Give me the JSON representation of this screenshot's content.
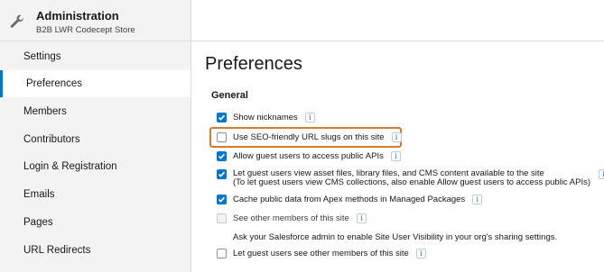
{
  "app": {
    "title": "Administration",
    "subtitle": "B2B LWR Codecept Store",
    "icon": "wrench-icon"
  },
  "sidebar": {
    "items": [
      {
        "label": "Settings",
        "active": false
      },
      {
        "label": "Preferences",
        "active": true
      },
      {
        "label": "Members",
        "active": false
      },
      {
        "label": "Contributors",
        "active": false
      },
      {
        "label": "Login & Registration",
        "active": false
      },
      {
        "label": "Emails",
        "active": false
      },
      {
        "label": "Pages",
        "active": false
      },
      {
        "label": "URL Redirects",
        "active": false
      }
    ]
  },
  "main": {
    "title": "Preferences",
    "section": "General",
    "options": [
      {
        "label": "Show nicknames",
        "checked": true,
        "info": true
      },
      {
        "label": "Use SEO-friendly URL slugs on this site",
        "checked": false,
        "info": true
      },
      {
        "label": "Allow guest users to access public APIs",
        "checked": true,
        "info": true
      },
      {
        "label": "Let guest users view asset files, library files, and CMS content available to the site",
        "line2": "(To let guest users view CMS collections, also enable Allow guest users to access public APIs)",
        "checked": true,
        "info": true
      },
      {
        "label": "Cache public data from Apex methods in Managed Packages",
        "checked": true,
        "info": true
      },
      {
        "label": "See other members of this site",
        "checked": false,
        "disabled": true,
        "info": true
      },
      {
        "label": "Let guest users see other members of this site",
        "checked": false,
        "info": true
      }
    ],
    "note": "Ask your Salesforce admin to enable Site User Visibility in your org's sharing settings.",
    "info_glyph": "i"
  },
  "colors": {
    "accent": "#0176d3",
    "highlight": "#d97a2b",
    "sidebar_bg": "#f3f3f3"
  }
}
